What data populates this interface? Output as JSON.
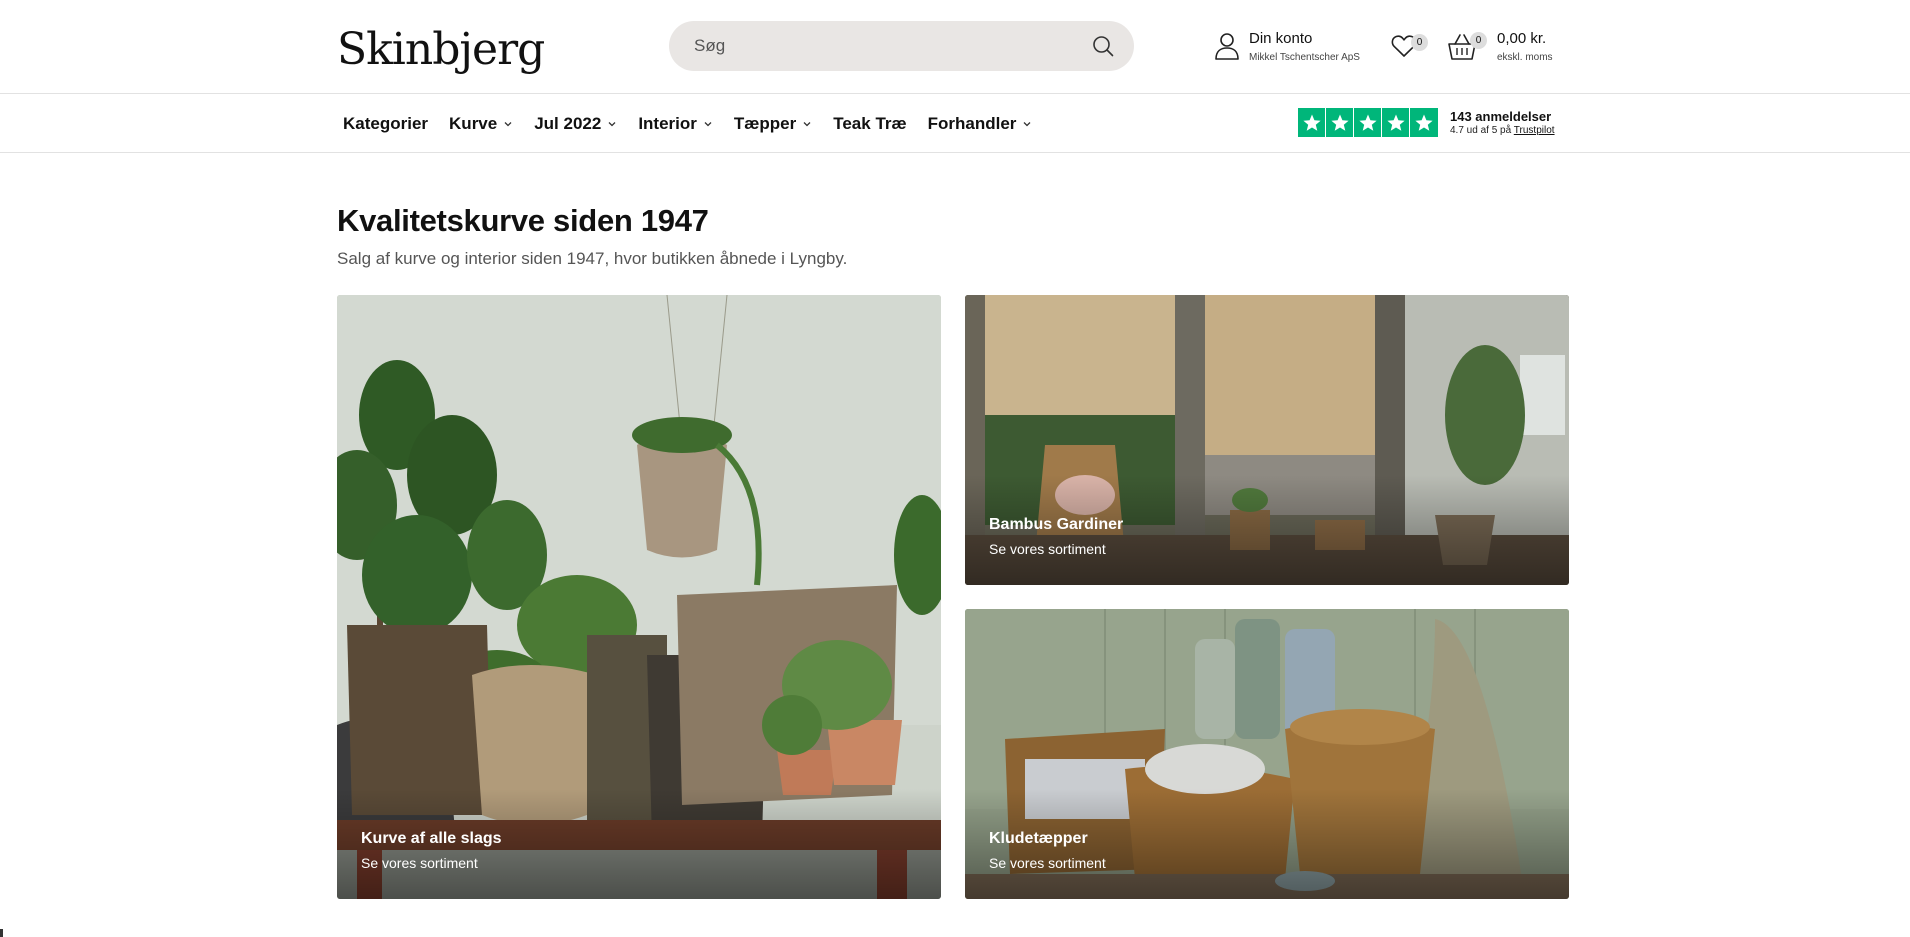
{
  "header": {
    "logo": "Skinbjerg",
    "search_placeholder": "Søg",
    "account_label": "Din konto",
    "account_company": "Mikkel Tschentscher ApS",
    "wishlist_count": "0",
    "cart_count": "0",
    "cart_total": "0,00 kr.",
    "cart_tax_note": "ekskl. moms"
  },
  "nav": {
    "items": [
      {
        "label": "Kategorier"
      },
      {
        "label": "Kurve"
      },
      {
        "label": "Jul 2022"
      },
      {
        "label": "Interior"
      },
      {
        "label": "Tæpper"
      },
      {
        "label": "Teak Træ"
      },
      {
        "label": "Forhandler"
      }
    ]
  },
  "trustpilot": {
    "reviews": "143 anmeldelser",
    "rating_prefix": "4.7 ud af 5 på",
    "brand": "Trustpilot",
    "stars": 5,
    "color": "#00b67a"
  },
  "main": {
    "title": "Kvalitetskurve siden 1947",
    "subtitle": "Salg af kurve og interior siden 1947, hvor butikken åbnede i Lyngby.",
    "tiles": [
      {
        "title": "Kurve af alle slags",
        "link": "Se vores sortiment"
      },
      {
        "title": "Bambus Gardiner",
        "link": "Se vores sortiment"
      },
      {
        "title": "Kludetæpper",
        "link": "Se vores sortiment"
      }
    ]
  }
}
